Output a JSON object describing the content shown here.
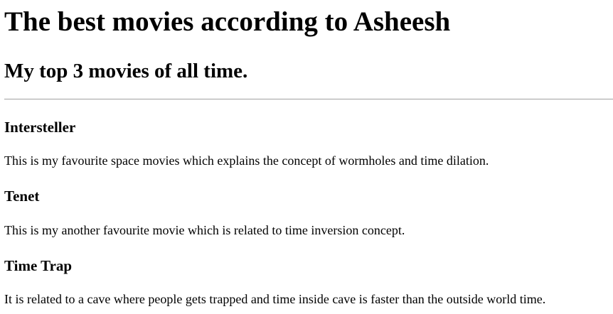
{
  "page": {
    "heading": "The best movies according to Asheesh",
    "subheading": "My top 3 movies of all time."
  },
  "movies": [
    {
      "title": "Intersteller",
      "description": "This is my favourite space movies which explains the concept of wormholes and time dilation."
    },
    {
      "title": "Tenet",
      "description": "This is my another favourite movie which is related to time inversion concept."
    },
    {
      "title": "Time Trap",
      "description": "It is related to a cave where people gets trapped and time inside cave is faster than the outside world time."
    }
  ]
}
